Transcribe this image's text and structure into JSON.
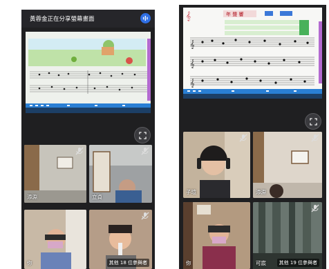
{
  "left_phone": {
    "share_banner": "黃蓉金正在分享螢幕畫面",
    "tiles": [
      {
        "name": "添淵",
        "muted": true
      },
      {
        "name": "立貞",
        "muted": true
      },
      {
        "name": "你",
        "muted": false
      },
      {
        "name": "",
        "muted": true,
        "more": "其他 18 位參與者"
      }
    ]
  },
  "right_phone": {
    "score_title": "年 聲 響",
    "tiles": [
      {
        "name": "子瑄",
        "muted": true
      },
      {
        "name": "添淵",
        "muted": true
      },
      {
        "name": "你",
        "muted": false
      },
      {
        "name": "可宸",
        "muted": true,
        "more": "其他 19 位參與者"
      }
    ]
  },
  "colors": {
    "phone_bg": "#1f1f21",
    "accent": "#2f6fe4"
  },
  "icons": [
    "audio-icon",
    "fullscreen-icon",
    "mic-off-icon"
  ]
}
